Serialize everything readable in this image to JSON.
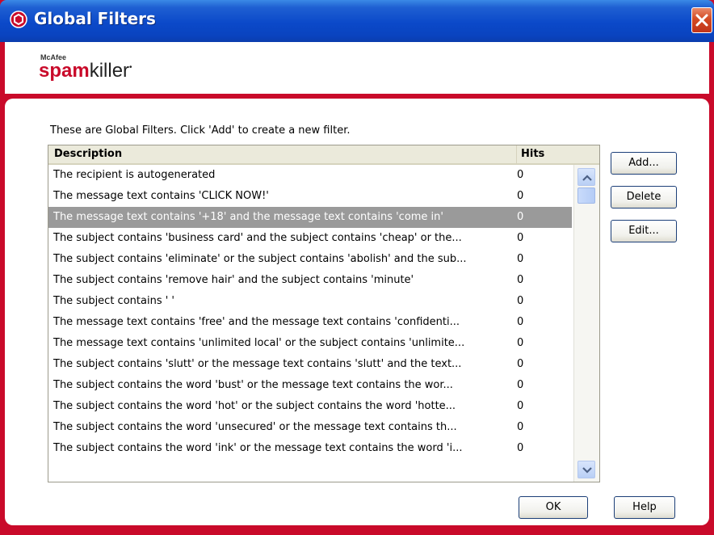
{
  "window": {
    "title": "Global Filters"
  },
  "banner": {
    "brand_small": "McAfee",
    "brand_spam": "spam",
    "brand_killer": "killer",
    "brand_mark": "•"
  },
  "intro_text": "These are Global Filters. Click 'Add' to create a new filter.",
  "list": {
    "columns": {
      "description": "Description",
      "hits": "Hits"
    },
    "selected_index": 2,
    "rows": [
      {
        "description": "The recipient is autogenerated",
        "hits": "0"
      },
      {
        "description": "The message text contains 'CLICK NOW!'",
        "hits": "0"
      },
      {
        "description": "The message text contains '+18' and the message text contains 'come in'",
        "hits": "0"
      },
      {
        "description": "The subject contains 'business card' and the subject contains 'cheap' or the...",
        "hits": "0"
      },
      {
        "description": "The subject contains 'eliminate' or the subject contains 'abolish' and the sub...",
        "hits": "0"
      },
      {
        "description": "The subject contains 'remove hair' and the subject contains 'minute'",
        "hits": "0"
      },
      {
        "description": "The subject contains '   '",
        "hits": "0"
      },
      {
        "description": "The message text contains 'free' and the message text contains 'confidenti...",
        "hits": "0"
      },
      {
        "description": "The message text contains 'unlimited local' or the subject contains 'unlimite...",
        "hits": "0"
      },
      {
        "description": "The subject contains 'slutt' or the message text contains 'slutt' and the text...",
        "hits": "0"
      },
      {
        "description": "The subject contains the word 'bust' or the message text contains the wor...",
        "hits": "0"
      },
      {
        "description": "The subject contains the word 'hot' or the subject contains the word 'hotte...",
        "hits": "0"
      },
      {
        "description": "The subject contains the word 'unsecured' or the message text contains th...",
        "hits": "0"
      },
      {
        "description": "The subject contains the word 'ink' or the message text contains the word 'i...",
        "hits": "0"
      }
    ]
  },
  "buttons": {
    "add": "Add...",
    "delete": "Delete",
    "edit": "Edit...",
    "ok": "OK",
    "help": "Help"
  },
  "icons": {
    "app": "mcafee-shield-icon",
    "close": "close-icon",
    "scroll_up": "chevron-up-icon",
    "scroll_down": "chevron-down-icon"
  },
  "colors": {
    "titlebar": "#0b49c9",
    "frame": "#c90a2a",
    "selected_row": "#9a9a9a"
  }
}
